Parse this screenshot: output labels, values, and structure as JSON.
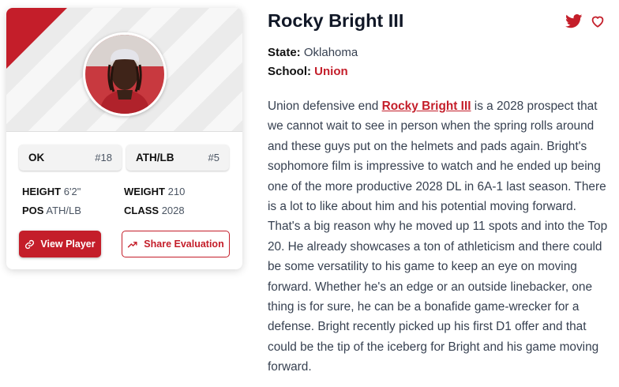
{
  "player": {
    "name": "Rocky Bright III",
    "state_label": "State:",
    "state": "Oklahoma",
    "school_label": "School:",
    "school": "Union"
  },
  "card": {
    "state_abbr": "OK",
    "state_rank": "#18",
    "position": "ATH/LB",
    "position_rank": "#5",
    "height_label": "HEIGHT",
    "height": "6'2\"",
    "weight_label": "WEIGHT",
    "weight": "210",
    "pos_label": "POS",
    "pos": "ATH/LB",
    "class_label": "CLASS",
    "class": "2028",
    "view_button": "View Player",
    "share_button": "Share Evaluation"
  },
  "bio": {
    "before": "Union defensive end ",
    "link": "Rocky Bright III",
    "after": " is a 2028 prospect that we cannot wait to see in person when the spring rolls around and these guys put on the helmets and pads again. Bright's sophomore film is impressive to watch and he ended up being one of the more productive 2028 DL in 6A-1 last season. There is a lot to like about him and his potential moving forward. That's a big reason why he moved up 11 spots and into the Top 20. He already showcases a ton of athleticism and there could be some versatility to his game to keep an eye on moving forward. Whether he's an edge or an outside linebacker, one thing is for sure, he can be a bonafide game-wrecker for a defense. Bright recently picked up his first D1 offer and that could be the tip of the iceberg for Bright and his game moving forward."
  },
  "colors": {
    "accent": "#c41e2a"
  },
  "icons": [
    "link-icon",
    "trending-up-icon",
    "twitter-icon",
    "heart-icon"
  ]
}
